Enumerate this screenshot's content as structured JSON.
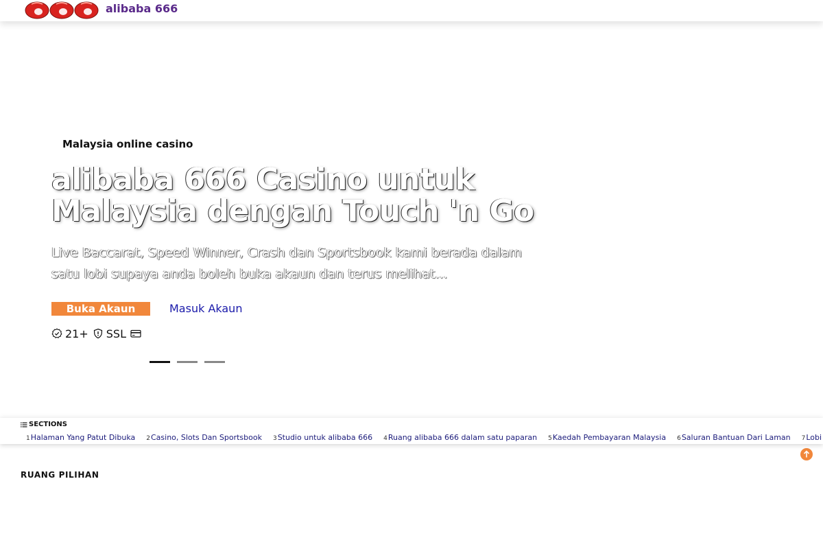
{
  "header": {
    "logo_text": "666",
    "brand": "alibaba 666"
  },
  "hero": {
    "kicker": "Malaysia online casino",
    "headline": "alibaba 666 Casino untuk Malaysia dengan Touch 'n Go",
    "subtitle": "Live Baccarat, Speed Winner, Crash dan Sportsbook kami berada dalam satu lobi supaya anda boleh buka akaun dan terus melihat...",
    "cta_primary": "Buka Akaun",
    "cta_secondary": "Masuk Akaun",
    "trust": {
      "age": "21+",
      "ssl": "SSL"
    },
    "slides": {
      "total": 3,
      "active": 1
    }
  },
  "sections": {
    "title": "SECTIONS",
    "items": [
      {
        "num": "1",
        "label": "Halaman Yang Patut Dibuka"
      },
      {
        "num": "2",
        "label": "Casino, Slots Dan Sportsbook"
      },
      {
        "num": "3",
        "label": "Studio untuk alibaba 666"
      },
      {
        "num": "4",
        "label": "Ruang alibaba 666 dalam satu paparan"
      },
      {
        "num": "5",
        "label": "Kaedah Pembayaran Malaysia"
      },
      {
        "num": "6",
        "label": "Saluran Bantuan Dari Laman"
      },
      {
        "num": "7",
        "label": "Lobi Ringa"
      }
    ]
  },
  "ruang_title": "RUANG PILIHAN",
  "colors": {
    "accent": "#f1873b",
    "brand": "#5a2a8a",
    "logo_red": "#d8231f",
    "link": "#1a1aaa"
  },
  "icons": {
    "age": "verified-badge-icon",
    "ssl": "shield-icon",
    "card": "credit-card-icon",
    "sections": "list-icon",
    "totop": "arrow-up-icon"
  }
}
